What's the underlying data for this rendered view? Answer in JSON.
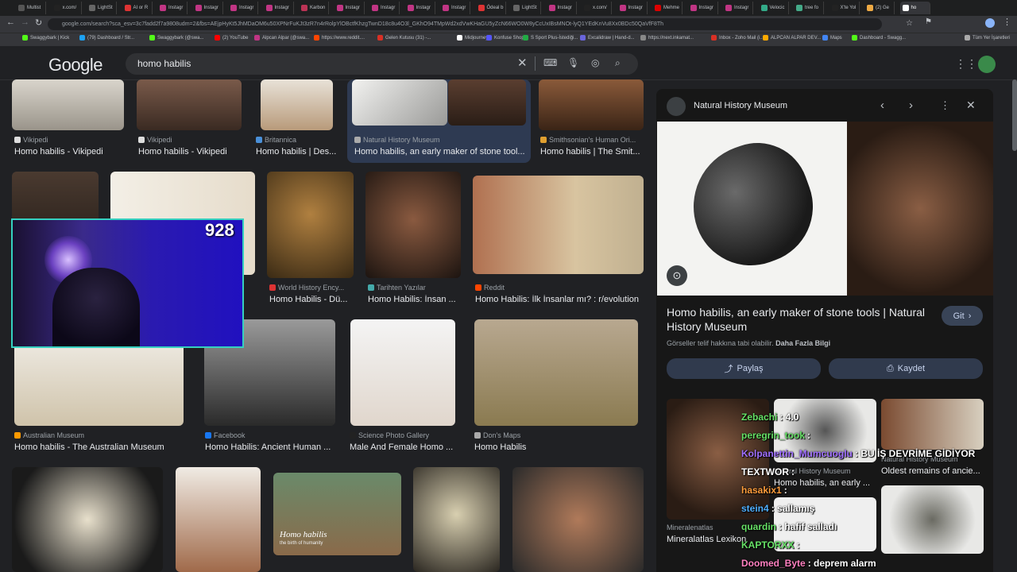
{
  "browser": {
    "tabs": [
      "Multist",
      "x.com/",
      "LightSt",
      "AI or R",
      "Instagr",
      "Instagr",
      "Instagr",
      "Instagr",
      "Karbon",
      "Instagr",
      "Instagr",
      "Instagr",
      "Instagr",
      "Ödeal b",
      "LightSt",
      "Instagr",
      "x.com/",
      "Instagr",
      "Mehme",
      "Instagr",
      "Instagr",
      "Velocic",
      "tree fo",
      "X'te Yol",
      "(2) Ge",
      "ho"
    ],
    "url": "google.com/search?sca_esv=3c7fadd2f7a9808udm=2&fbs=AEjpHyKt5JhMDaOM6u50XPNrFuKJt3zR7n4rRolpYlOBctfKhzgTwnD18c8u4O3l_GKhO94TMpWd2xdVwKHaGU5yZcN66WO0W8yCcUxIBsMNOt-lyQ1YEdKnVu8Xx0BDc50QaVfF8Th",
    "bookmarks": [
      "Swaggybark | Kick",
      "(79) Dashboard / Str...",
      "Swaggybark (@swa...",
      "(2) YouTube",
      "Alpcan Alpar (@swa...",
      "https://www.reddit....",
      "Gelen Kutusu (31) -...",
      "Midjourney",
      "Konfuse Shop",
      "S Sport Plus-İstediği...",
      "Excalidraw | Hand-d...",
      "https://next.inkamat...",
      "Inbox - Zoho Mail (i...",
      "ALPCAN ALPAR DEV...",
      "Maps",
      "Dashboard - Swagg...",
      "Tüm Yer İşaretleri"
    ]
  },
  "google": {
    "logo": "Google",
    "query": "homo habilis"
  },
  "results": {
    "row1": [
      {
        "source": "Vikipedi",
        "title": "Homo habilis - Vikipedi"
      },
      {
        "source": "Vikipedi",
        "title": "Homo habilis - Vikipedi"
      },
      {
        "source": "Britannica",
        "title": "Homo habilis | Des..."
      },
      {
        "source": "Natural History Museum",
        "title": "Homo habilis, an early maker of stone tool..."
      },
      {
        "source": "Smithsonian's Human Ori...",
        "title": "Homo habilis | The Smit..."
      }
    ],
    "row2": [
      {
        "source": "World History Ency...",
        "title": "Homo Habilis - Dü..."
      },
      {
        "source": "Tarihten Yazılar",
        "title": "Homo Habilis: İnsan ..."
      },
      {
        "source": "Reddit",
        "title": "Homo Habilis: İlk İnsanlar mı? : r/evolution"
      }
    ],
    "row3": [
      {
        "source": "Australian Museum",
        "title": "Homo habilis - The Australian Museum"
      },
      {
        "source": "Facebook",
        "title": "Homo Habilis: Ancient Human ..."
      },
      {
        "source": "Science Photo Gallery",
        "title": "Male And Female Homo ..."
      },
      {
        "source": "Don's Maps",
        "title": "Homo Habilis"
      }
    ],
    "row4_caption": "Homo habilis",
    "row4_subcaption": "the birth of humanity"
  },
  "panel": {
    "source": "Natural History Museum",
    "title": "Homo habilis, an early maker of stone tools | Natural History Museum",
    "go_label": "Git",
    "copyright": "Görseller telif hakkına tabi olabilir.",
    "more_info": "Daha Fazla Bilgi",
    "share_label": "Paylaş",
    "save_label": "Kaydet",
    "related": [
      {
        "source": "Mineralenatlas",
        "title": "Mineralatlas Lexikon"
      },
      {
        "source": "Natural History Museum",
        "title": "Homo habilis, an early ..."
      },
      {
        "source": "Natural History Museum",
        "title": "Oldest remains of ancie..."
      }
    ]
  },
  "overlay": {
    "viewer_count": "928",
    "chat": [
      {
        "user": "Zebachi",
        "msg": ": 4.0",
        "color": "#66e066"
      },
      {
        "user": "peregrin_took",
        "msg": ":",
        "color": "#66e066"
      },
      {
        "user": "Kolpanettin_Mumcuoglu",
        "msg": ": BU İŞ DEVRİME GİDİYOR",
        "color": "#a070ff"
      },
      {
        "user": "TEXTWOR",
        "msg": ":",
        "color": "#ffffff"
      },
      {
        "user": "hasakix1",
        "msg": ":",
        "color": "#ff9d3b"
      },
      {
        "user": "stein4",
        "msg": ": sallamış",
        "color": "#4fb0ff"
      },
      {
        "user": "quardin",
        "msg": ": hafif salladı",
        "color": "#66e066"
      },
      {
        "user": "KAPTORXX",
        "msg": ":",
        "color": "#66e066"
      },
      {
        "user": "Doomed_Byte",
        "msg": ": deprem alarm",
        "color": "#ff80c0"
      }
    ]
  }
}
